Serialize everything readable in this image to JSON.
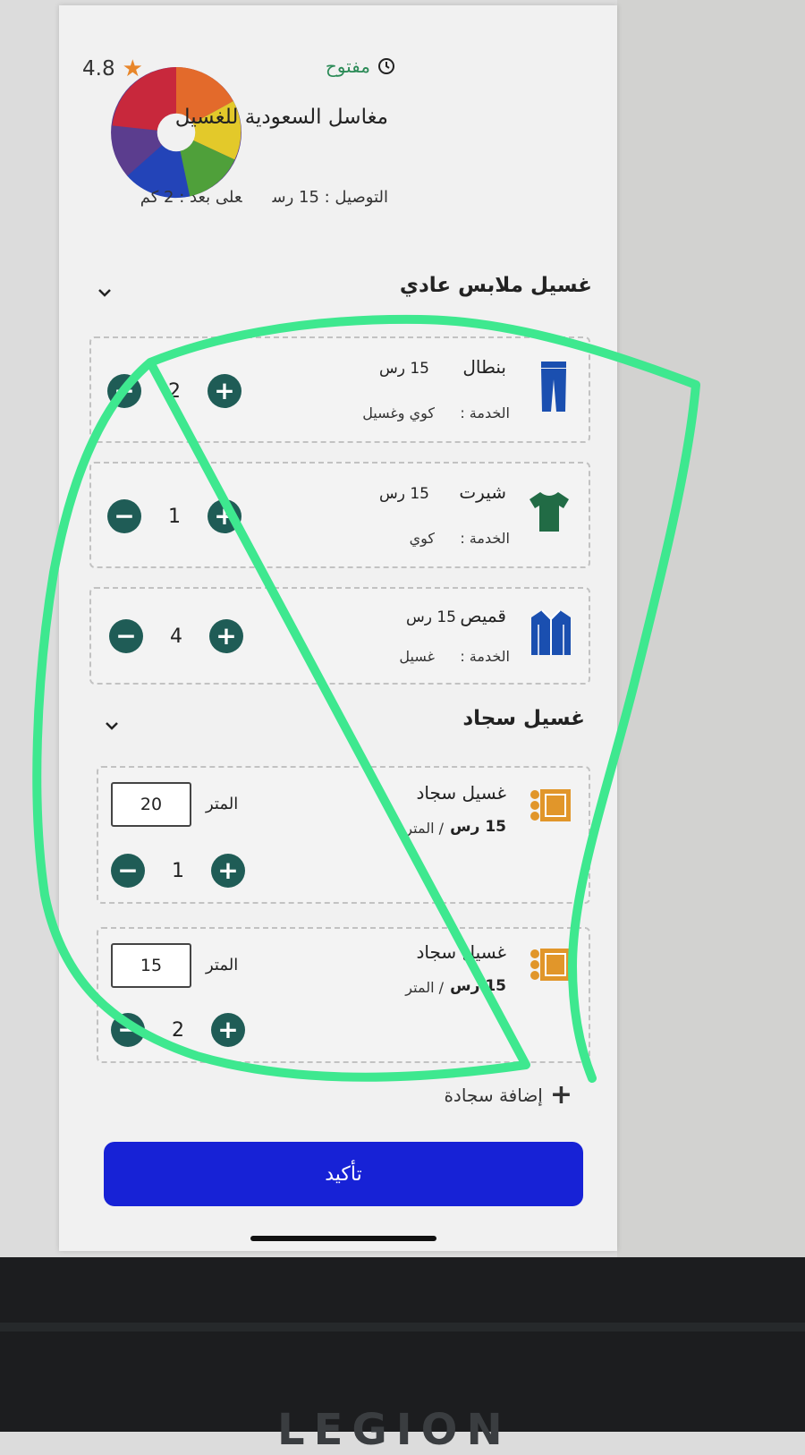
{
  "shop": {
    "name": "مغاسل السعودية للغسيل",
    "status": "مفتوح",
    "rating": "4.8",
    "delivery": "التوصيل : 15 رس",
    "distance": "على بعد : 2 كم"
  },
  "sections": [
    {
      "title": "غسيل ملابس عادي",
      "items": [
        {
          "name": "بنطال",
          "price": "15 رس",
          "service_label": "الخدمة :",
          "service": "كوي وغسيل",
          "qty": "2",
          "icon": "pants-icon",
          "color": "#1a4fb0"
        },
        {
          "name": "شيرت",
          "price": "15 رس",
          "service_label": "الخدمة :",
          "service": "كوي",
          "qty": "1",
          "icon": "tshirt-icon",
          "color": "#216b45"
        },
        {
          "name": "قميص",
          "price": "15 رس",
          "service_label": "الخدمة :",
          "service": "غسيل",
          "qty": "4",
          "icon": "shirt-icon",
          "color": "#1a4fb0"
        }
      ]
    },
    {
      "title": "غسيل سجاد",
      "items": [
        {
          "name": "غسيل سجاد",
          "price": "15 رس",
          "per": "/ المتر",
          "meter_label": "المتر",
          "meters": "20",
          "qty": "1",
          "icon": "rug-icon",
          "color": "#e1962a"
        },
        {
          "name": "غسيل سجاد",
          "price": "15 رس",
          "per": "/ المتر",
          "meter_label": "المتر",
          "meters": "15",
          "qty": "2",
          "icon": "rug-icon",
          "color": "#e1962a"
        }
      ]
    }
  ],
  "add_rug": "إضافة سجادة",
  "confirm": "تأكيد",
  "colors": {
    "accent": "#1722d6",
    "stepper": "#1f5c56",
    "annotation": "#3ee88f",
    "open": "#2a8a56",
    "star": "#e8862a"
  },
  "monitor_brand": "LEGION"
}
